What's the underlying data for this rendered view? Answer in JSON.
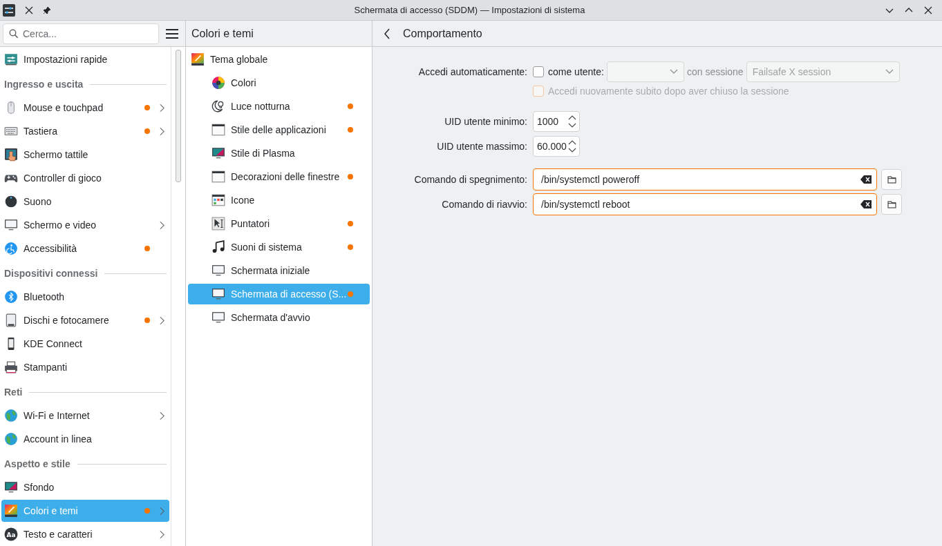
{
  "window": {
    "title": "Schermata di accesso (SDDM) — Impostazioni di sistema"
  },
  "sidebar": {
    "search": {
      "placeholder": "Cerca..."
    },
    "items": [
      {
        "kind": "item",
        "label": "Impostazioni rapide",
        "modified": false,
        "expandable": false,
        "selected": false
      },
      {
        "kind": "header",
        "label": "Ingresso e uscita"
      },
      {
        "kind": "item",
        "label": "Mouse e touchpad",
        "modified": true,
        "expandable": true,
        "selected": false
      },
      {
        "kind": "item",
        "label": "Tastiera",
        "modified": true,
        "expandable": true,
        "selected": false
      },
      {
        "kind": "item",
        "label": "Schermo tattile",
        "modified": false,
        "expandable": false,
        "selected": false
      },
      {
        "kind": "item",
        "label": "Controller di gioco",
        "modified": false,
        "expandable": false,
        "selected": false
      },
      {
        "kind": "item",
        "label": "Suono",
        "modified": false,
        "expandable": false,
        "selected": false
      },
      {
        "kind": "item",
        "label": "Schermo e video",
        "modified": false,
        "expandable": true,
        "selected": false
      },
      {
        "kind": "item",
        "label": "Accessibilità",
        "modified": true,
        "expandable": false,
        "selected": false
      },
      {
        "kind": "header",
        "label": "Dispositivi connessi"
      },
      {
        "kind": "item",
        "label": "Bluetooth",
        "modified": false,
        "expandable": false,
        "selected": false
      },
      {
        "kind": "item",
        "label": "Dischi e fotocamere",
        "modified": true,
        "expandable": true,
        "selected": false
      },
      {
        "kind": "item",
        "label": "KDE Connect",
        "modified": false,
        "expandable": false,
        "selected": false
      },
      {
        "kind": "item",
        "label": "Stampanti",
        "modified": false,
        "expandable": false,
        "selected": false
      },
      {
        "kind": "header",
        "label": "Reti"
      },
      {
        "kind": "item",
        "label": "Wi-Fi e Internet",
        "modified": false,
        "expandable": true,
        "selected": false
      },
      {
        "kind": "item",
        "label": "Account in linea",
        "modified": false,
        "expandable": false,
        "selected": false
      },
      {
        "kind": "header",
        "label": "Aspetto e stile"
      },
      {
        "kind": "item",
        "label": "Sfondo",
        "modified": false,
        "expandable": false,
        "selected": false
      },
      {
        "kind": "item",
        "label": "Colori e temi",
        "modified": true,
        "expandable": true,
        "selected": true
      },
      {
        "kind": "item",
        "label": "Testo e caratteri",
        "glyph": "Aa",
        "modified": false,
        "expandable": true,
        "selected": false
      }
    ]
  },
  "subpanel": {
    "title": "Colori e temi",
    "items": [
      {
        "label": "Tema globale",
        "modified": false,
        "selected": false,
        "children": [
          {
            "label": "Colori",
            "modified": false,
            "selected": false
          },
          {
            "label": "Luce notturna",
            "modified": true,
            "selected": false
          },
          {
            "label": "Stile delle applicazioni",
            "modified": true,
            "selected": false
          },
          {
            "label": "Stile di Plasma",
            "modified": false,
            "selected": false
          },
          {
            "label": "Decorazioni delle finestre",
            "modified": true,
            "selected": false
          },
          {
            "label": "Icone",
            "modified": false,
            "selected": false
          },
          {
            "label": "Puntatori",
            "modified": true,
            "selected": false
          },
          {
            "label": "Suoni di sistema",
            "modified": true,
            "selected": false
          },
          {
            "label": "Schermata iniziale",
            "modified": false,
            "selected": false
          },
          {
            "label": "Schermata di accesso (S...",
            "modified": true,
            "selected": true
          },
          {
            "label": "Schermata d'avvio",
            "modified": false,
            "selected": false
          }
        ]
      }
    ]
  },
  "page": {
    "title": "Comportamento",
    "autologin": {
      "label": "Accedi automaticamente:",
      "checkbox_label": "come utente:",
      "checked": false,
      "session_label": "con sessione",
      "session": "Failsafe X session",
      "session_disabled": true,
      "relogin": {
        "label": "Accedi nuovamente subito dopo aver chiuso la sessione",
        "checked": false,
        "disabled": true
      }
    },
    "spinboxes": [
      {
        "label": "UID utente minimo:",
        "value": "1000"
      },
      {
        "label": "UID utente massimo:",
        "value": "60.000"
      }
    ],
    "commands": [
      {
        "label": "Comando di spegnimento:",
        "value": "/bin/systemctl poweroff"
      },
      {
        "label": "Comando di riavvio:",
        "value": "/bin/systemctl reboot"
      }
    ]
  }
}
